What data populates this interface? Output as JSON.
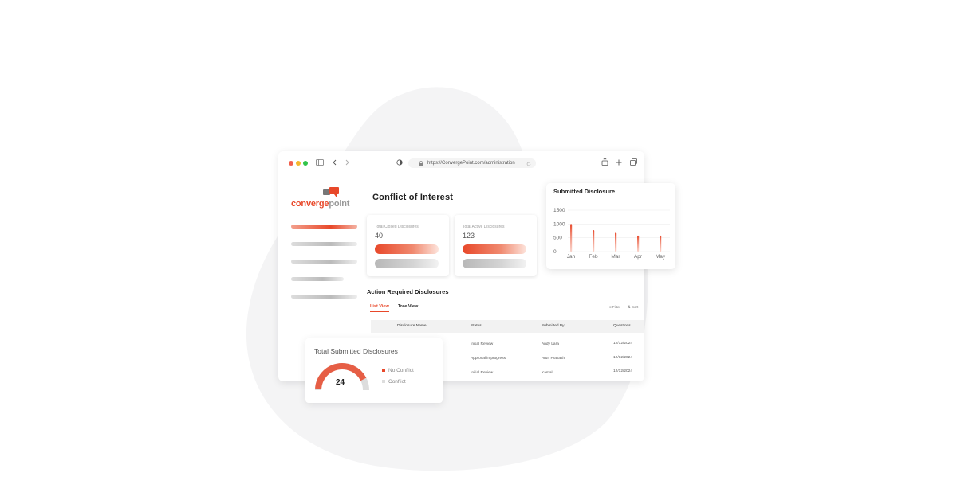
{
  "browser": {
    "url": "https://ConvergePoint.com/administration"
  },
  "logo": {
    "part1": "converge",
    "part2": "point"
  },
  "page": {
    "title": "Conflict of Interest"
  },
  "stats": [
    {
      "label": "Total Closed Disclosures",
      "value": "40"
    },
    {
      "label": "Total Active Disclosures",
      "value": "123"
    }
  ],
  "section": {
    "title": "Action Required Disclosures",
    "tabs": [
      "List View",
      "Tree View"
    ],
    "active_tab": "List View",
    "filter_label": "Filter",
    "sort_label": "Sort"
  },
  "table": {
    "columns": [
      "Disclosure Name",
      "Status",
      "Submitted By",
      "Questions"
    ],
    "rows": [
      {
        "name": "",
        "status": "Initial Review",
        "submitted_by": "Andy Lara",
        "date": "12/12/2024"
      },
      {
        "name": "",
        "status": "Approval in progress",
        "submitted_by": "Arun Prakash",
        "date": "12/12/2024"
      },
      {
        "name": "",
        "status": "Initial Review",
        "submitted_by": "Kamal",
        "date": "12/12/2024"
      }
    ]
  },
  "submitted_chart": {
    "title": "Submitted Disclosure"
  },
  "chart_data": {
    "type": "bar",
    "title": "Submitted Disclosure",
    "categories": [
      "Jan",
      "Feb",
      "Mar",
      "Apr",
      "May"
    ],
    "values": [
      1000,
      780,
      680,
      580,
      580
    ],
    "yticks": [
      "1500",
      "1000",
      "500",
      "0"
    ],
    "ylim": [
      0,
      1500
    ],
    "grid": true
  },
  "donut": {
    "title": "Total Submitted Disclosures",
    "value": "24",
    "legend": [
      {
        "label": "No Conflict",
        "color": "#e8482a"
      },
      {
        "label": "Conflict",
        "color": "#dddddd"
      }
    ],
    "fraction_no_conflict": 0.85
  },
  "colors": {
    "accent": "#e8482a",
    "window_dots": [
      "#f25f4c",
      "#f5b82e",
      "#31c44a"
    ]
  }
}
